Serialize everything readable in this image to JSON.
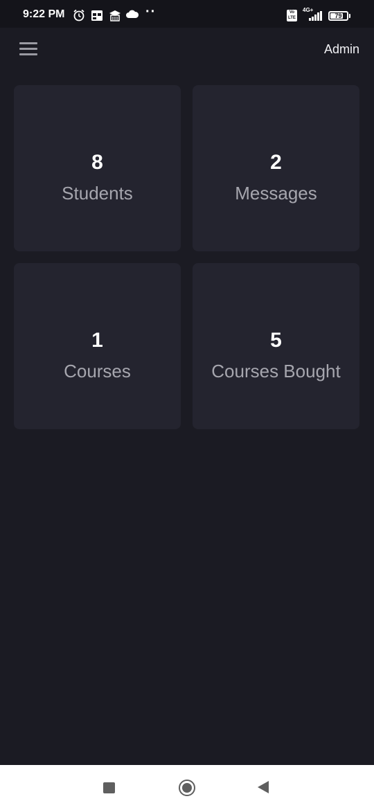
{
  "status_bar": {
    "time": "9:22 PM",
    "icons": [
      "alarm-icon",
      "calendar-icon",
      "school-icon",
      "cloud-icon"
    ],
    "more": "··",
    "volte": "Vo\nLTE",
    "network": "4G+",
    "battery": "79",
    "battery_level": 0.79
  },
  "header": {
    "menu_icon": "hamburger-menu-icon",
    "user_label": "Admin"
  },
  "stats": [
    {
      "value": "8",
      "label": "Students"
    },
    {
      "value": "2",
      "label": "Messages"
    },
    {
      "value": "1",
      "label": "Courses"
    },
    {
      "value": "5",
      "label": "Courses Bought"
    }
  ],
  "colors": {
    "background": "#1b1b23",
    "card": "#24242f",
    "status_bar": "#14141a",
    "label_text": "#a6a6ae",
    "value_text": "#ffffff"
  },
  "nav_bar": {
    "icons": [
      "recent-apps-icon",
      "home-icon",
      "back-icon"
    ]
  }
}
